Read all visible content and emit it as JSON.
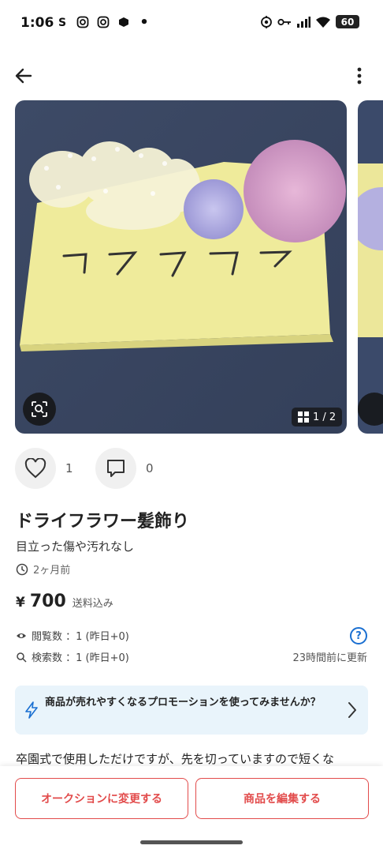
{
  "status_bar": {
    "time": "1:06",
    "left_icons": [
      "S",
      "instagram",
      "instagram",
      "app",
      "•"
    ],
    "battery": "60"
  },
  "gallery": {
    "page_indicator": "1 / 2",
    "photos": 2
  },
  "social": {
    "likes": "1",
    "comments": "0"
  },
  "item": {
    "title": "ドライフラワー髪飾り",
    "condition": "目立った傷や汚れなし",
    "posted_ago": "2ヶ月前",
    "currency": "¥",
    "price": "700",
    "shipping_note": "送料込み"
  },
  "stats": {
    "views_label": "閲覧数 ：1 (昨日+0)",
    "search_label": "検索数 ：1 (昨日+0)",
    "updated": "23時間前に更新"
  },
  "promo": {
    "text": "商品が売れやすくなるプロモーションを使ってみませんか？"
  },
  "description": "卒園式で使用しただけですが、先を切っていますので短くな",
  "actions": {
    "auction_label": "オークションに変更する",
    "edit_label": "商品を編集する"
  },
  "colors": {
    "accent_red": "#e24b4b",
    "link_blue": "#1a6fd1",
    "promo_bg": "#e9f4fb"
  }
}
